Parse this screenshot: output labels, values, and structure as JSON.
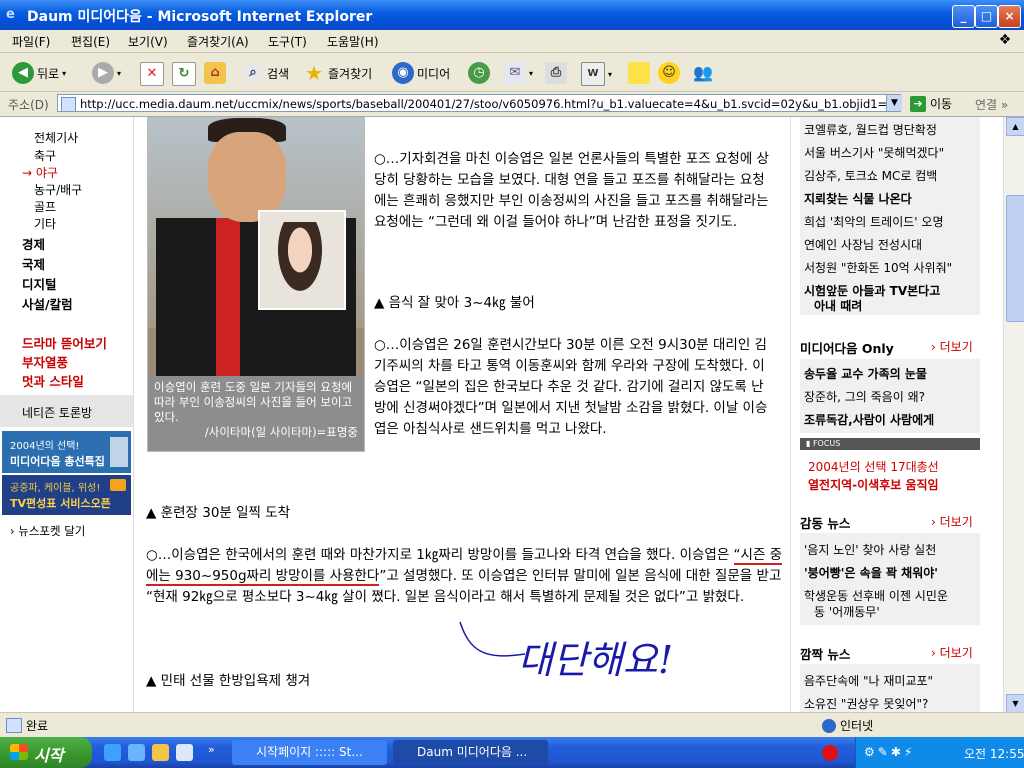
{
  "window": {
    "title": "Daum 미디어다음 - Microsoft Internet Explorer"
  },
  "menubar": [
    "파일(F)",
    "편집(E)",
    "보기(V)",
    "즐겨찾기(A)",
    "도구(T)",
    "도움말(H)"
  ],
  "toolbar": {
    "back": "뒤로",
    "search": "검색",
    "favorites": "즐겨찾기",
    "media": "미디어"
  },
  "address": {
    "label": "주소(D)",
    "url": "http://ucc.media.daum.net/uccmix/news/sports/baseball/200401/27/stoo/v6050976.html?u_b1.valuecate=4&u_b1.svcid=02y&u_b1.objid1=16602",
    "go": "이동",
    "links": "연결"
  },
  "leftnav": {
    "sub_items": [
      "전체기사",
      "축구",
      "→ 야구",
      "농구/배구",
      "골프",
      "기타"
    ],
    "categories": [
      "경제",
      "국제",
      "디지털",
      "사설/칼럼"
    ],
    "featured": [
      "드라마 뜯어보기",
      "부자열풍",
      "멋과 스타일"
    ],
    "netizen": "네티즌 토론방",
    "banner1_line1": "2004년의 선택!",
    "banner1_line2": "미디어다음 총선특집",
    "banner2_line1": "공중파, 케이블, 위성!",
    "banner2_line2": "TV편성표 서비스오픈",
    "newspocket": "› 뉴스포켓 달기"
  },
  "photo": {
    "caption": "이승엽이 훈련 도중 일본 기자들의 요청에 따라 부인 이송정씨의 사진을 들어 보이고 있다.",
    "credit": "/사이타마(일 사이타마)=표명중"
  },
  "article": {
    "para1": "○…기자회견을 마친 이승엽은 일본 언론사들의 특별한 포즈 요청에 상당히 당황하는 모습을 보였다. 대형 연을 들고 포즈를 취해달라는 요청에는 흔쾌히 응했지만 부인 이송정씨의 사진을 들고 포즈를 취해달라는 요청에는 “그런데 왜 이걸 들어야 하나”며 난감한 표정을 짓기도.",
    "head2": "▲ 음식 잘 맞아 3~4㎏ 불어",
    "para2": "○…이승엽은 26일 훈련시간보다 30분 이른 오전 9시30분 대리인 김기주씨의 차를 타고 통역 이동훈씨와 함께 우라와 구장에 도착했다. 이승엽은 “일본의 집은 한국보다 추운 것 같다. 감기에 걸리지 않도록 난방에 신경써야겠다”며 일본에서 지낸 첫날밤 소감을 밝혔다. 이날 이승엽은 아침식사로 샌드위치를 먹고 나왔다.",
    "head3": "▲ 훈련장 30분 일찍 도착",
    "para3_a": "○…이승엽은 한국에서의 훈련 때와 마찬가지로 1㎏짜리 방망이를 들고나와 타격 연습을 했다. 이승엽은 ",
    "para3_quote": "“시즌 중에는 930~950g짜리 방망이를 사용한다",
    "para3_b": "”고 설명했다. 또 이승엽은 인터뷰 말미에 일본 음식에 대한 질문을 받고 “현재 92㎏으로 평소보다 3~4㎏ 살이 쪘다. 일본 음식이라고 해서 특별하게 문제될 것은 없다”고 밝혔다.",
    "head4": "▲ 민태 선물 한방입욕제 챙겨",
    "handwriting": "대단해요!"
  },
  "right": {
    "box1": [
      "코엘류호, 월드컵 명단확정",
      "서울 버스기사 \"못해먹겠다\"",
      "김상주, 토크쇼 MC로 컴백",
      "지뢰찾는 식물 나온다",
      "희섭 '최악의 트레이드' 오명",
      "연예인 사장님 전성시대",
      "서청원 \"한화돈 10억 사위줘\"",
      "시험앞둔 아들과 TV본다고",
      "아내 때려"
    ],
    "only_title": "미디어다음 Only",
    "more": "› 더보기",
    "box2": [
      "송두율 교수 가족의 눈물",
      "장준하, 그의 죽음이 왜?",
      "조류독감,사람이 사람에게"
    ],
    "focus_tag": "▮ FOCUS",
    "focus1": "2004년의 선택 17대총선",
    "focus2": "열전지역-이색후보 움직임",
    "touching_title": "감동 뉴스",
    "box3": [
      "'음지 노인' 찾아 사랑 실천",
      "'붕어빵'은 속을 꽉 채워야'",
      "학생운동 선후배 이젠 시민운",
      "동 '어깨동무'"
    ],
    "surprise_title": "깜짝 뉴스",
    "box4": [
      "음주단속에 \"나 재미교포\"",
      "소유진 \"권상우 못잊어\"?"
    ]
  },
  "status": {
    "text": "완료",
    "zone": "인터넷"
  },
  "taskbar": {
    "start": "시작",
    "task1": "시작페이지 ::::: St...",
    "task2": "Daum 미디어다음 ...",
    "clock": "오전 12:55"
  }
}
